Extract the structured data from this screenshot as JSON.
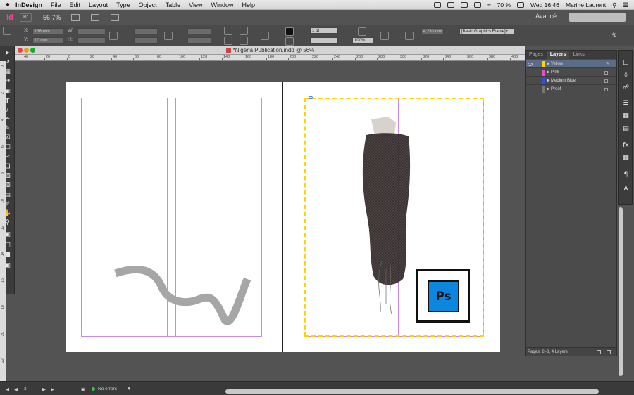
{
  "menubar": {
    "app_name": "InDesign",
    "items": [
      "File",
      "Edit",
      "Layout",
      "Type",
      "Object",
      "Table",
      "View",
      "Window",
      "Help"
    ],
    "battery": "70 %",
    "clock": "Wed 16:46",
    "user": "Marine Laurent"
  },
  "appbar": {
    "logo": "Id",
    "br_label": "Br",
    "zoom": "56,7%",
    "workspace": "Avancé"
  },
  "control": {
    "x_label": "X:",
    "y_label": "Y:",
    "w_label": "W:",
    "h_label": "H:",
    "x_value": "138 mm",
    "y_value": "10 mm",
    "stroke_weight": "1 pt",
    "opacity": "100%",
    "width_value": "4,233 mm",
    "object_style": "[Basic Graphics Frame]+"
  },
  "document": {
    "tab_title": "*Nigeria Publication.indd @ 56%"
  },
  "ruler": {
    "ticks": [
      "40",
      "20",
      "0",
      "20",
      "40",
      "60",
      "80",
      "100",
      "120",
      "140",
      "160",
      "180",
      "200",
      "220",
      "240",
      "260",
      "280",
      "300",
      "320",
      "340",
      "360",
      "380",
      "400"
    ]
  },
  "vruler": {
    "ticks": [
      "0",
      "2",
      "4",
      "6",
      "8",
      "10",
      "12",
      "14",
      "16",
      "18",
      "20",
      "22"
    ]
  },
  "pages": {
    "ps_label": "Ps"
  },
  "layers_panel": {
    "tabs": [
      "Pages",
      "Layers",
      "Links"
    ],
    "active_tab": "Layers",
    "layers": [
      {
        "name": "Yellow",
        "color": "#ffd400",
        "selected": true
      },
      {
        "name": "Pink",
        "color": "#e34fd3",
        "selected": false
      },
      {
        "name": "Medium Blue",
        "color": "#2a55d6",
        "selected": false
      },
      {
        "name": "Proof",
        "color": "#777777",
        "selected": false
      }
    ],
    "footer": "Pages: 2–3, 4 Layers"
  },
  "status": {
    "page": "3",
    "preflight": "No errors"
  },
  "colors": {
    "guide": "#c58be6",
    "frame": "#ffd400",
    "ps_blue": "#0b87e0"
  }
}
